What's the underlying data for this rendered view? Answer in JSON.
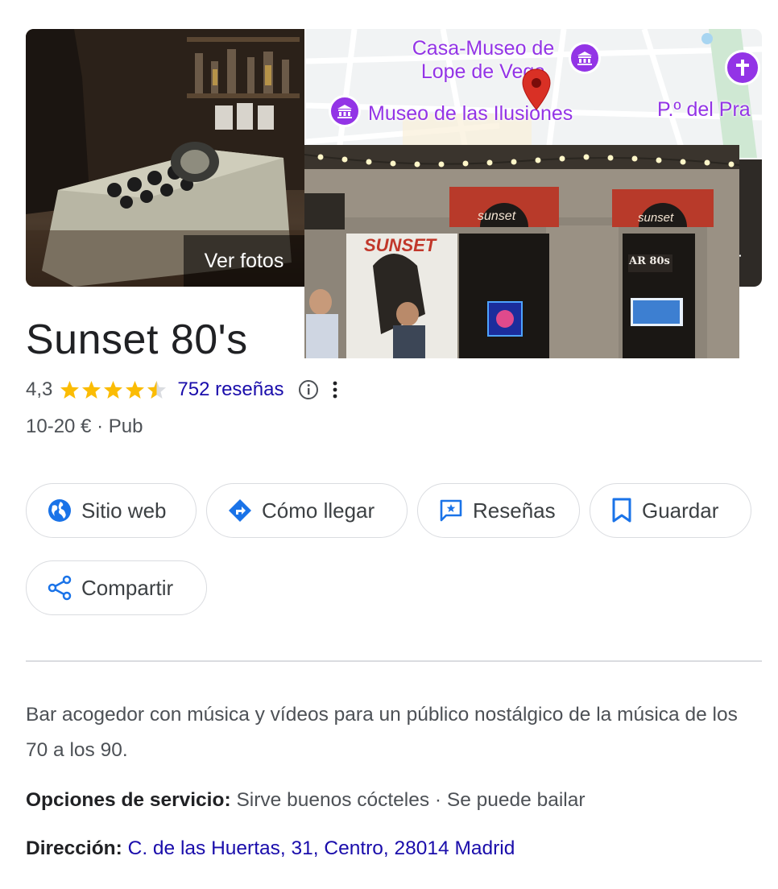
{
  "photos": {
    "see_photos_label": "Ver fotos",
    "storefront_signs": [
      "sunset",
      "sunset",
      "SUNSET",
      "AR 80s"
    ],
    "right_cut_label": "r"
  },
  "map": {
    "labels": {
      "museum_top": "Casa-Museo de\nLope de Vega",
      "museum_bottom": "Museo de las Ilusiones",
      "street": "P.º del Pra"
    },
    "pin_color": "#d93025",
    "poi_color": "#9334e6"
  },
  "place": {
    "name": "Sunset 80's",
    "rating": "4,3",
    "rating_value": 4.3,
    "reviews_label": "752 reseñas",
    "price_range": "10-20 €",
    "category": "Pub",
    "separator": "·"
  },
  "actions": [
    {
      "label": "Sitio web",
      "icon": "globe-icon"
    },
    {
      "label": "Cómo llegar",
      "icon": "directions-icon"
    },
    {
      "label": "Reseñas",
      "icon": "reviews-icon"
    },
    {
      "label": "Guardar",
      "icon": "bookmark-icon"
    },
    {
      "label": "Compartir",
      "icon": "share-icon"
    }
  ],
  "details": {
    "description": "Bar acogedor con música y vídeos para un público nostálgico de la música de los 70 a los 90.",
    "service_options_label": "Opciones de servicio:",
    "service_options_value": "Sirve buenos cócteles · Se puede bailar",
    "address_label": "Dirección:",
    "address_value": "C. de las Huertas, 31, Centro, 28014 Madrid"
  },
  "colors": {
    "star": "#fbbc04",
    "link": "#1a0dab",
    "icon_blue": "#1a73e8"
  }
}
